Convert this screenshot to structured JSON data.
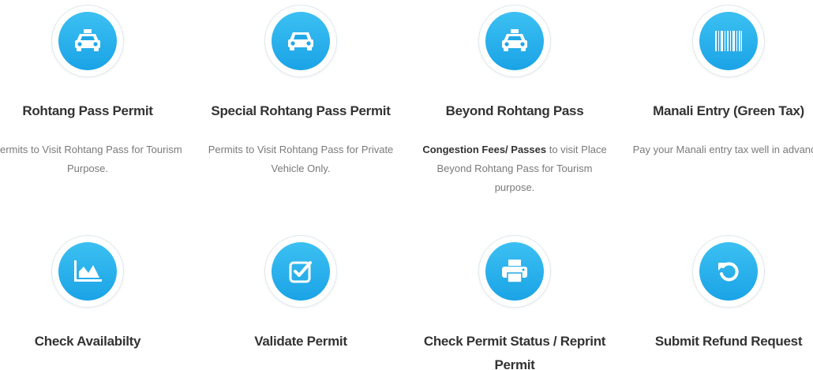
{
  "cards": [
    {
      "title": "Rohtang Pass Permit",
      "icon": "taxi-icon",
      "desc": "Permits to Visit Rohtang Pass for Tourism Purpose."
    },
    {
      "title": "Special Rohtang Pass Permit",
      "icon": "car-icon",
      "desc": "Permits to Visit Rohtang Pass for Private Vehicle Only."
    },
    {
      "title": "Beyond Rohtang Pass",
      "icon": "taxi-icon",
      "desc_bold": "Congestion Fees/ Passes",
      "desc": " to visit Place Beyond Rohtang Pass for Tourism purpose."
    },
    {
      "title": "Manali Entry (Green Tax)",
      "icon": "barcode-icon",
      "desc": "Pay your Manali entry tax well in advance."
    },
    {
      "title": "Check Availabilty",
      "icon": "area-chart-icon"
    },
    {
      "title": "Validate Permit",
      "icon": "check-square-icon"
    },
    {
      "title": "Check Permit Status / Reprint Permit",
      "icon": "print-icon"
    },
    {
      "title": "Submit Refund Request",
      "icon": "undo-icon"
    }
  ],
  "colors": {
    "accent": "#1aa3e6",
    "title": "#333333",
    "text": "#7a7a7a"
  }
}
